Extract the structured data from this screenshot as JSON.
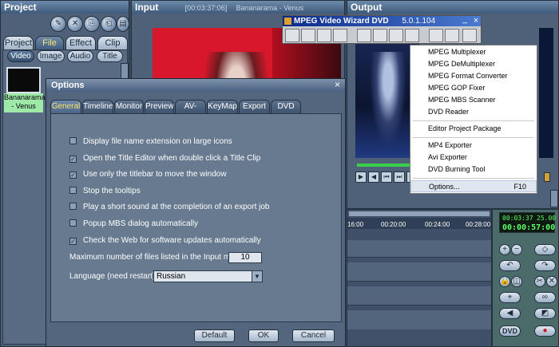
{
  "project": {
    "title": "Project",
    "tabs": [
      "Project",
      "File",
      "Effect",
      "Clip"
    ],
    "active_tab": "File",
    "subtabs": [
      "Video",
      "Image",
      "Audio",
      "Title"
    ],
    "active_subtab": "Video",
    "clip_name": "Bananarama - Venus"
  },
  "input": {
    "title": "Input",
    "timecode": "[00:03:37:06]",
    "clip": "Bananarama - Venus"
  },
  "output": {
    "title": "Output"
  },
  "mpeg_toolbar": {
    "title": "MPEG Video Wizard DVD",
    "version": "5.0.1.104",
    "minimize": "_",
    "close": "×"
  },
  "menu": {
    "items": [
      {
        "label": "MPEG Multiplexer"
      },
      {
        "label": "MPEG DeMultiplexer"
      },
      {
        "label": "MPEG Format Converter"
      },
      {
        "label": "MPEG GOP Fixer"
      },
      {
        "label": "MPEG MBS Scanner"
      },
      {
        "label": "DVD Reader"
      },
      {
        "label": "Editor Project Package"
      },
      {
        "label": "MP4 Exporter"
      },
      {
        "label": "Avi Exporter"
      },
      {
        "label": "DVD Burning Tool"
      },
      {
        "label": "Options...",
        "shortcut": "F10"
      }
    ]
  },
  "options": {
    "title": "Options",
    "close": "×",
    "tabs": [
      "General",
      "Timeline",
      "Monitor",
      "Preview",
      "AV-Sync",
      "KeyMap",
      "Export",
      "DVD"
    ],
    "active_tab": "General",
    "checkboxes": [
      {
        "label": "Display file name extension on large icons",
        "checked": false
      },
      {
        "label": "Open the Title Editor when double click a Title Clip",
        "checked": true
      },
      {
        "label": "Use only the titlebar to move the window",
        "checked": true
      },
      {
        "label": "Stop the tooltips",
        "checked": false
      },
      {
        "label": "Play a short sound at the completion of an export job",
        "checked": false
      },
      {
        "label": "Popup MBS dialog automatically",
        "checked": false
      },
      {
        "label": "Check the Web for software updates automatically",
        "checked": true
      }
    ],
    "max_files_label": "Maximum number of files listed in the Input menu :",
    "max_files_value": "10",
    "language_label": "Language (need restart):",
    "language_value": "Russian",
    "buttons": {
      "default": "Default",
      "ok": "OK",
      "cancel": "Cancel"
    }
  },
  "timeline": {
    "marks": [
      "16:00",
      "00:20:00",
      "00:24:00",
      "00:28:00"
    ]
  },
  "control_panel": {
    "time_top_left": "00:03:37",
    "time_top_right": "25.00",
    "time_main": "00:00:57:00",
    "dvd_label": "DVD"
  },
  "colors": {
    "panel": "#4f6178",
    "dialog": "#54667d",
    "active_tab_text": "#ffe36b",
    "menu_bg": "#ffffff",
    "mpeg_title_start": "#0a2a8a"
  }
}
